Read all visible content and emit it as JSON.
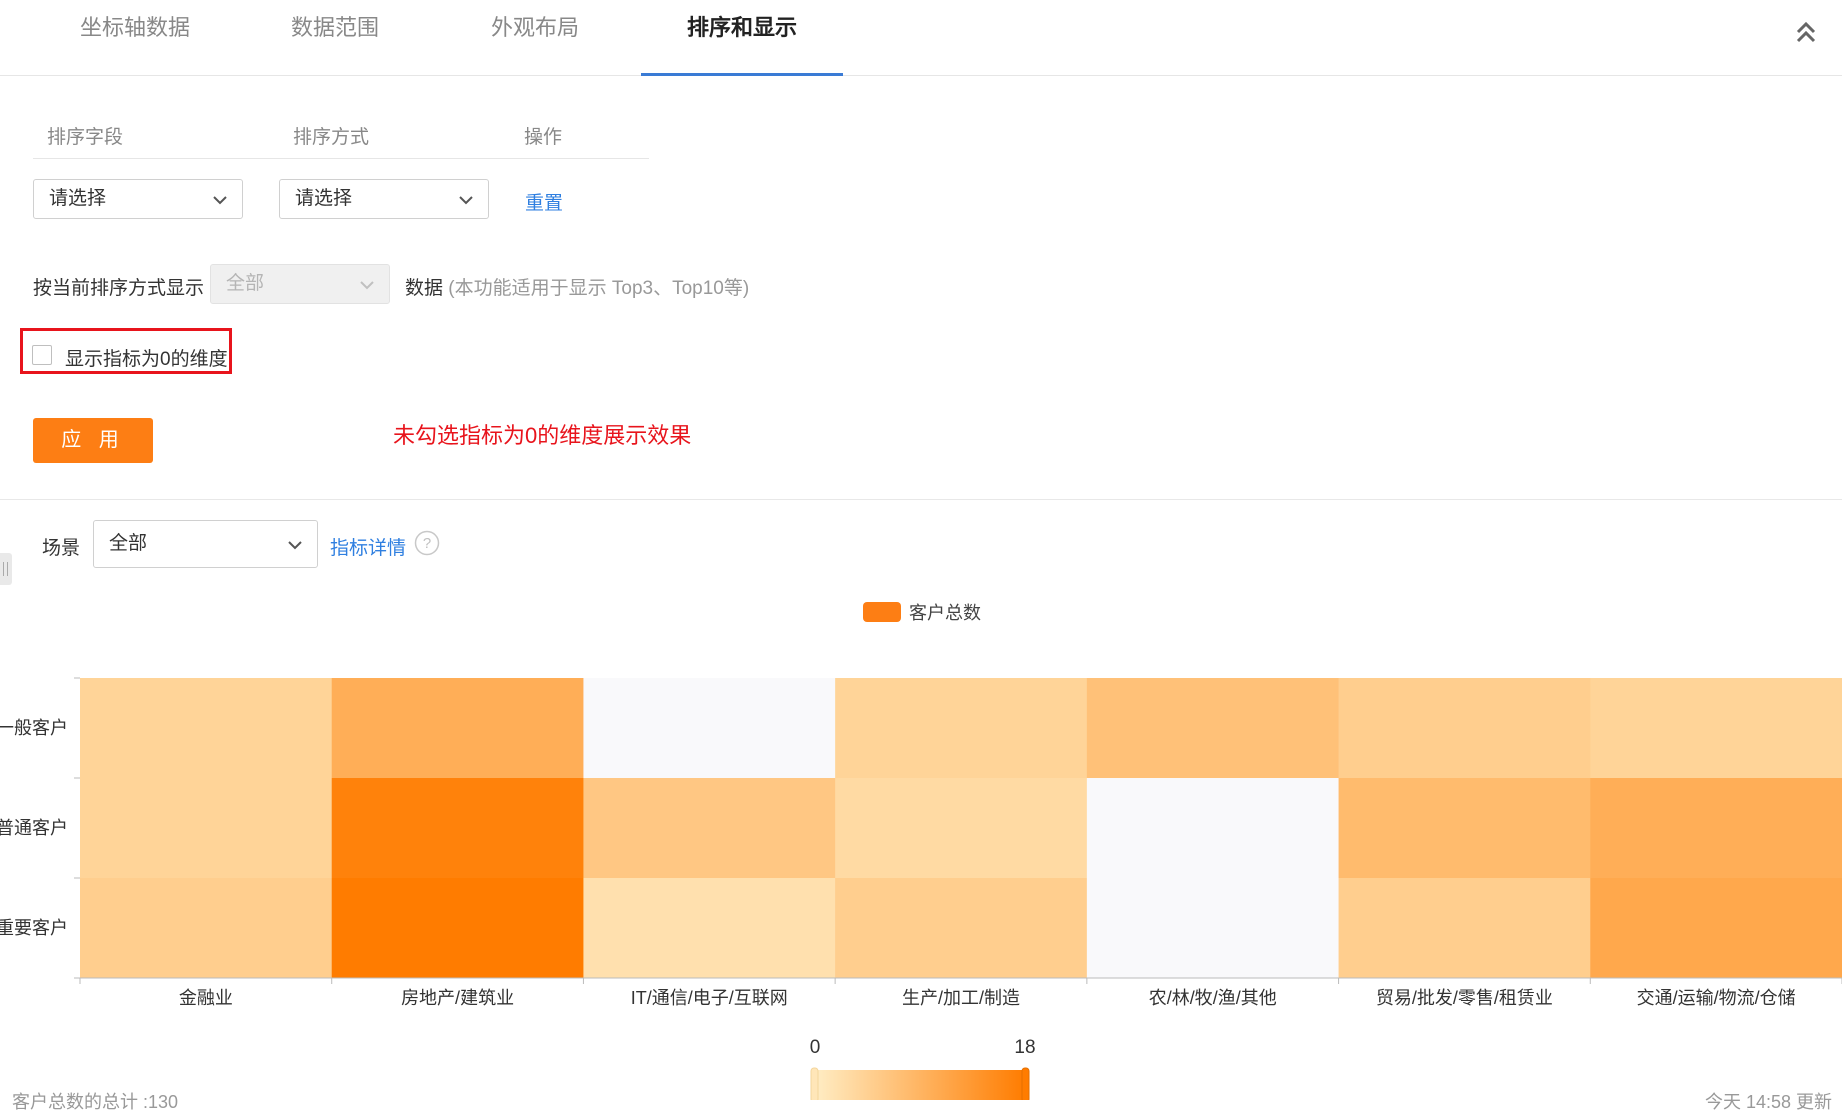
{
  "tabs": [
    {
      "label": "坐标轴数据",
      "active": false
    },
    {
      "label": "数据范围",
      "active": false
    },
    {
      "label": "外观布局",
      "active": false
    },
    {
      "label": "排序和显示",
      "active": true
    }
  ],
  "collapse_icon": "double-chevron-up-icon",
  "sort_table": {
    "headers": [
      "排序字段",
      "排序方式",
      "操作"
    ],
    "field_select": "请选择",
    "order_select": "请选择",
    "reset_link": "重置"
  },
  "display_by_order": {
    "label": "按当前排序方式显示",
    "select_value": "全部",
    "suffix": "数据",
    "hint": "(本功能适用于显示 Top3、Top10等)"
  },
  "show_zero_checkbox": {
    "label": "显示指标为0的维度",
    "checked": false
  },
  "apply_button": "应 用",
  "annotation": "未勾选指标为0的维度展示效果",
  "scene": {
    "label": "场景",
    "select_value": "全部",
    "detail_link": "指标详情"
  },
  "colors": {
    "accent": "#fd7e14",
    "link": "#2f7fe0",
    "annotation": "#e8141c",
    "tab_underline": "#3a7bd5"
  },
  "chart_data": {
    "type": "heatmap",
    "legend": [
      "客户总数"
    ],
    "x_categories": [
      "金融业",
      "房地产/建筑业",
      "IT/通信/电子/互联网",
      "生产/加工/制造",
      "农/林/牧/渔/其他",
      "贸易/批发/零售/租赁业",
      "交通/运输/物流/仓储"
    ],
    "y_categories": [
      "一般客户",
      "普通客户",
      "重要客户"
    ],
    "values": [
      [
        4,
        10,
        0,
        4,
        7,
        5,
        4
      ],
      [
        4,
        17,
        6,
        3,
        0,
        8,
        10
      ],
      [
        5,
        18,
        2,
        5,
        0,
        5,
        11
      ]
    ],
    "visual_map": {
      "min": 0,
      "max": 18,
      "min_label": "0",
      "max_label": "18"
    }
  },
  "footer": {
    "total": "客户总数的总计 :130",
    "updated": "今天 14:58 更新"
  }
}
